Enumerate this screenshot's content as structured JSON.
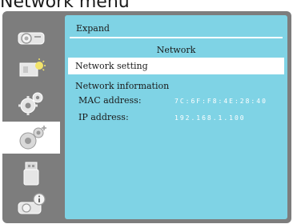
{
  "page_heading": "Network menu",
  "sidebar": {
    "tabs": [
      {
        "icon": "projector-icon",
        "selected": false
      },
      {
        "icon": "picture-icon",
        "selected": false
      },
      {
        "icon": "gear-icon",
        "selected": false
      },
      {
        "icon": "expand-gear-icon",
        "selected": true
      },
      {
        "icon": "usb-icon",
        "selected": false
      },
      {
        "icon": "info-icon",
        "selected": false
      }
    ]
  },
  "panel": {
    "title": "Expand",
    "section_title": "Network",
    "menu_item": "Network setting",
    "info_heading": "Network information",
    "mac_label": "MAC address:",
    "mac_value": "7C:6F:F8:4E:28:40",
    "ip_label": "IP address:",
    "ip_value": "192.168.1.100"
  },
  "colors": {
    "panel_bg": "#7fd3e5",
    "sidebar_bg": "#7d7d7d",
    "highlight": "#ffffff",
    "value_text": "#ffffff"
  }
}
